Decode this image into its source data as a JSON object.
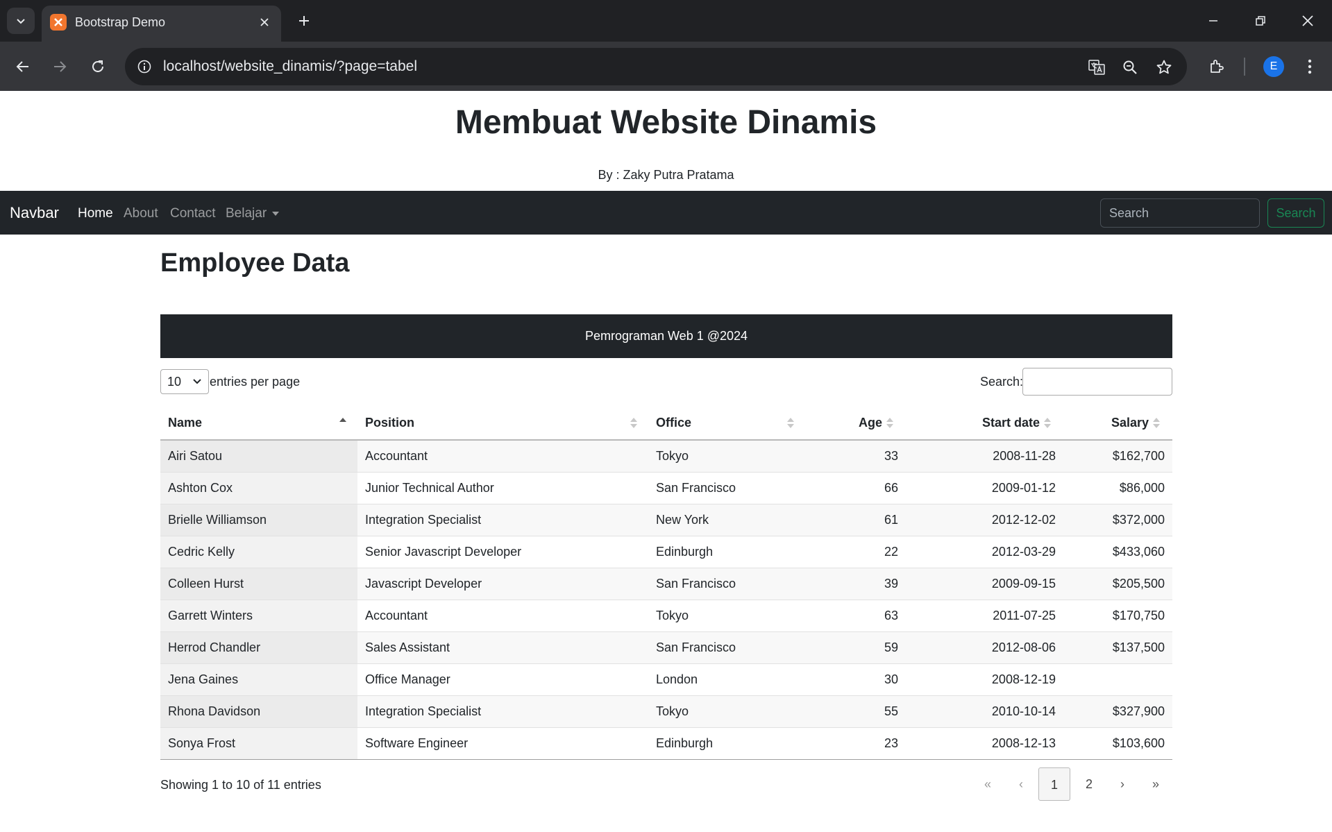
{
  "browser": {
    "tab_title": "Bootstrap Demo",
    "url": "localhost/website_dinamis/?page=tabel",
    "profile_initial": "E"
  },
  "header": {
    "title": "Membuat Website Dinamis",
    "subtitle": "By : Zaky Putra Pratama"
  },
  "navbar": {
    "brand": "Navbar",
    "links": [
      "Home",
      "About",
      "Contact",
      "Belajar"
    ],
    "search_placeholder": "Search",
    "search_button": "Search",
    "colors": {
      "background": "#212529",
      "search_button": "#198754"
    }
  },
  "main": {
    "title": "Employee Data",
    "banner": "Pemrograman Web 1 @2024",
    "page_length": "10",
    "page_length_label": "entries per page",
    "search_label": "Search:",
    "columns": [
      "Name",
      "Position",
      "Office",
      "Age",
      "Start date",
      "Salary"
    ],
    "rows": [
      [
        "Airi Satou",
        "Accountant",
        "Tokyo",
        "33",
        "2008-11-28",
        "$162,700"
      ],
      [
        "Ashton Cox",
        "Junior Technical Author",
        "San Francisco",
        "66",
        "2009-01-12",
        "$86,000"
      ],
      [
        "Brielle Williamson",
        "Integration Specialist",
        "New York",
        "61",
        "2012-12-02",
        "$372,000"
      ],
      [
        "Cedric Kelly",
        "Senior Javascript Developer",
        "Edinburgh",
        "22",
        "2012-03-29",
        "$433,060"
      ],
      [
        "Colleen Hurst",
        "Javascript Developer",
        "San Francisco",
        "39",
        "2009-09-15",
        "$205,500"
      ],
      [
        "Garrett Winters",
        "Accountant",
        "Tokyo",
        "63",
        "2011-07-25",
        "$170,750"
      ],
      [
        "Herrod Chandler",
        "Sales Assistant",
        "San Francisco",
        "59",
        "2012-08-06",
        "$137,500"
      ],
      [
        "Jena Gaines",
        "Office Manager",
        "London",
        "30",
        "2008-12-19",
        ""
      ],
      [
        "Rhona Davidson",
        "Integration Specialist",
        "Tokyo",
        "55",
        "2010-10-14",
        "$327,900"
      ],
      [
        "Sonya Frost",
        "Software Engineer",
        "Edinburgh",
        "23",
        "2008-12-13",
        "$103,600"
      ]
    ],
    "info": "Showing 1 to 10 of 11 entries",
    "pagination": {
      "first": "«",
      "prev": "‹",
      "pages": [
        "1",
        "2"
      ],
      "next": "›",
      "last": "»",
      "current": "1"
    }
  }
}
